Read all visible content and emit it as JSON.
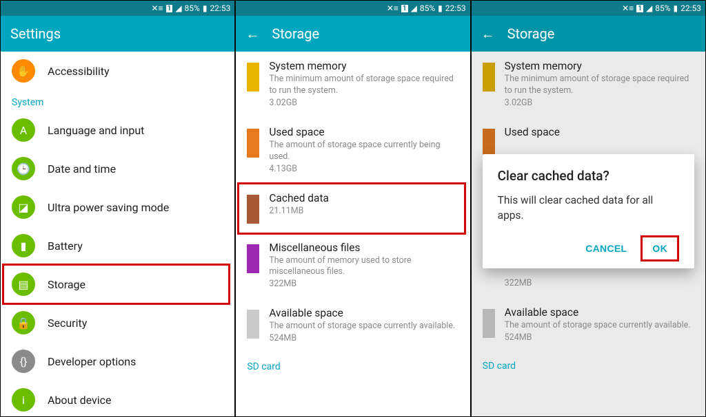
{
  "status": {
    "battery": "85%",
    "time": "22:53",
    "sim": "1"
  },
  "panel1": {
    "title": "Settings",
    "accessibility": "Accessibility",
    "sectionSystem": "System",
    "items": {
      "language": "Language and input",
      "datetime": "Date and time",
      "ultrapower": "Ultra power saving mode",
      "battery": "Battery",
      "storage": "Storage",
      "security": "Security",
      "developer": "Developer options",
      "about": "About device"
    }
  },
  "panel2": {
    "title": "Storage",
    "rows": {
      "sysmem": {
        "title": "System memory",
        "desc": "The minimum amount of storage space required to run the system.",
        "val": "3.02GB",
        "color": "#e9b400"
      },
      "used": {
        "title": "Used space",
        "desc": "The amount of storage space currently being used.",
        "val": "4.13GB",
        "color": "#e77a1f"
      },
      "cached": {
        "title": "Cached data",
        "desc": "",
        "val": "21.11MB",
        "color": "#a85a36"
      },
      "misc": {
        "title": "Miscellaneous files",
        "desc": "The amount of memory used to store miscellaneous files.",
        "val": "322MB",
        "color": "#9c27b0"
      },
      "avail": {
        "title": "Available space",
        "desc": "The amount of storage space currently available.",
        "val": "524MB",
        "color": "#c9c9c9"
      }
    },
    "sdcard": "SD card"
  },
  "panel3": {
    "title": "Storage",
    "rows": {
      "sysmem": {
        "title": "System memory",
        "desc": "The minimum amount of storage space required to run the system.",
        "val": "3.02GB"
      },
      "used": {
        "title": "Used space"
      },
      "miscval": "322MB",
      "avail": {
        "title": "Available space",
        "desc": "The amount of storage space currently available.",
        "val": "524MB"
      }
    },
    "sdcard": "SD card",
    "dialog": {
      "title": "Clear cached data?",
      "body": "This will clear cached data for all apps.",
      "cancel": "CANCEL",
      "ok": "OK"
    }
  }
}
